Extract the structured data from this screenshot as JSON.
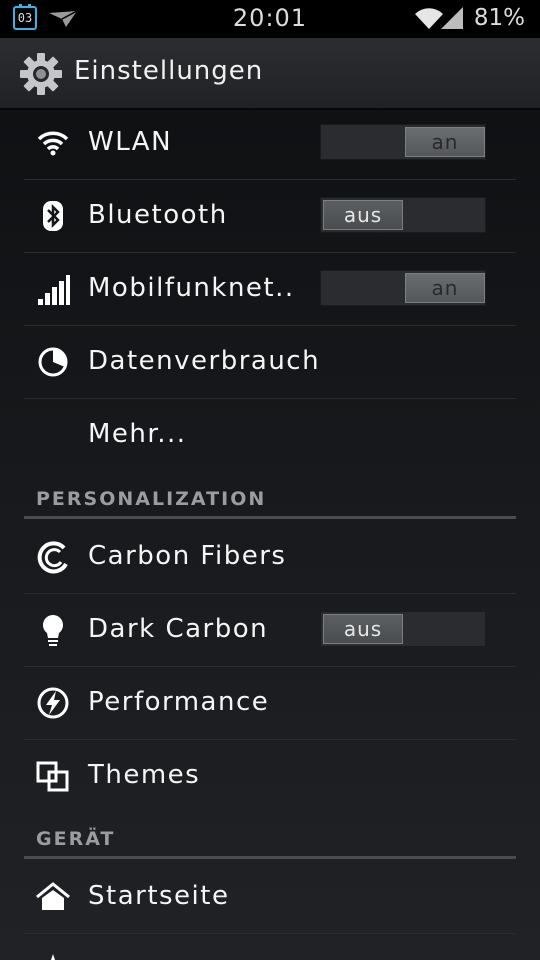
{
  "status_bar": {
    "calendar_day": "03",
    "clock": "20:01",
    "battery": "81%",
    "icons": [
      "calendar-icon",
      "paper-plane-icon",
      "wifi-icon",
      "signal-icon"
    ]
  },
  "action_bar": {
    "title": "Einstellungen",
    "icon": "gear-icon"
  },
  "rows": {
    "wlan": {
      "label": "WLAN",
      "icon": "wifi-icon",
      "toggle": "an",
      "state": "on"
    },
    "bluetooth": {
      "label": "Bluetooth",
      "icon": "bluetooth-icon",
      "toggle": "aus",
      "state": "off"
    },
    "mobile": {
      "label": "Mobilfunknet..",
      "icon": "signal-icon",
      "toggle": "an",
      "state": "on"
    },
    "data_usage": {
      "label": "Datenverbrauch",
      "icon": "data-usage-icon"
    },
    "more": {
      "label": "Mehr..."
    }
  },
  "sections": {
    "personalization": "PERSONALIZATION",
    "device": "GERÄT"
  },
  "personalization_rows": {
    "carbon_fibers": {
      "label": "Carbon Fibers",
      "icon": "carbon-logo-icon"
    },
    "dark_carbon": {
      "label": "Dark Carbon",
      "icon": "lightbulb-icon",
      "toggle": "aus",
      "state": "off"
    },
    "performance": {
      "label": "Performance",
      "icon": "performance-bolt-icon"
    },
    "themes": {
      "label": "Themes",
      "icon": "themes-icon"
    }
  },
  "device_rows": {
    "homescreen": {
      "label": "Startseite",
      "icon": "home-icon"
    }
  },
  "colors": {
    "accent": "#33b5e5",
    "background": "#16181b",
    "text": "#f5f5f5",
    "section_text": "#9a9ca0"
  }
}
